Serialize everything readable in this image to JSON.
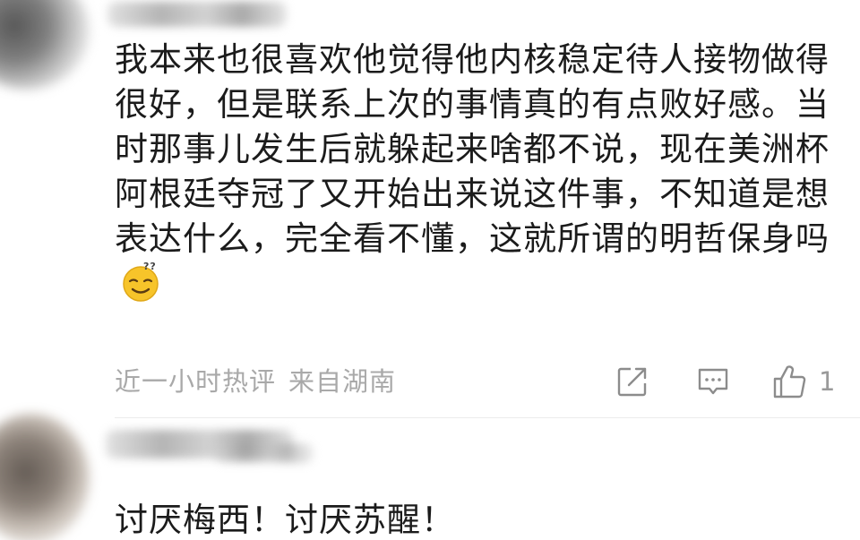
{
  "comments": [
    {
      "text": "我本来也很喜欢他觉得他内核稳定待人接物做得很好，但是联系上次的事情真的有点败好感。当时那事儿发生后就躲起来啥都不说，现在美洲杯阿根廷夺冠了又开始出来说这件事，不知道是想表达什么，完全看不懂，这就所谓的明哲保身吗",
      "emoji": "thinking-smirk-emoji",
      "time": "近一小时热评",
      "location": "来自湖南",
      "like_count": "1"
    },
    {
      "text": "讨厌梅西！讨厌苏醒！"
    }
  ],
  "icons": {
    "share": "share-icon",
    "reply": "reply-icon",
    "like": "thumbs-up-icon"
  },
  "colors": {
    "text": "#1b1b1b",
    "meta": "#a9a9a9",
    "icon": "#8c8c8c",
    "divider": "#ececec",
    "emoji": "#f7c42a"
  }
}
